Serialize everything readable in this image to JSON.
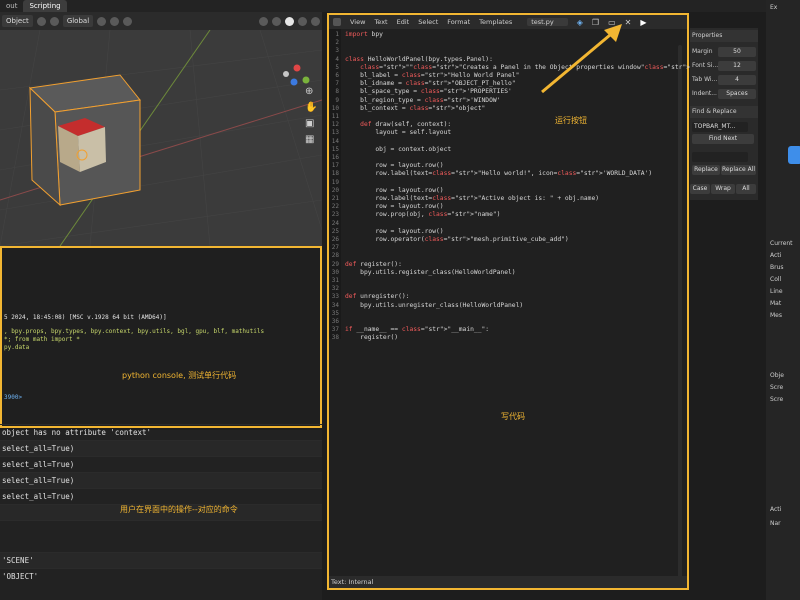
{
  "topbar": {
    "tabs": [
      "out",
      "Scripting"
    ]
  },
  "viewport_header": {
    "mode": "Object",
    "transform": "Global"
  },
  "console": {
    "lines": [
      "5 2024, 18:45:08) [MSC v.1928 64 bit (AMD64)]",
      ", bpy.props, bpy.types, bpy.context, bpy.utils, bgl, gpu, blf, mathutils",
      "*; from math import *",
      "py.data",
      "3900>"
    ],
    "annotation": "python console, 测试单行代码"
  },
  "infolog": {
    "rows": [
      "object has no attribute 'context'",
      "select_all=True)",
      "select_all=True)",
      "select_all=True)",
      "select_all=True)",
      "",
      "",
      "'SCENE'",
      "'OBJECT'"
    ],
    "annotation": "用户在界面中的操作--对应的命令"
  },
  "editor": {
    "menu": [
      "View",
      "Text",
      "Edit",
      "Select",
      "Format",
      "Templates"
    ],
    "filename": "test.py",
    "footer": "Text: Internal",
    "write_label": "写代码",
    "run_label": "运行按钮",
    "code": [
      "import bpy",
      "",
      "",
      "class HelloWorldPanel(bpy.types.Panel):",
      "    \"\"\"Creates a Panel in the Object properties window\"\"\"",
      "    bl_label = \"Hello World Panel\"",
      "    bl_idname = \"OBJECT_PT_hello\"",
      "    bl_space_type = 'PROPERTIES'",
      "    bl_region_type = 'WINDOW'",
      "    bl_context = \"object\"",
      "",
      "    def draw(self, context):",
      "        layout = self.layout",
      "",
      "        obj = context.object",
      "",
      "        row = layout.row()",
      "        row.label(text=\"Hello world!\", icon='WORLD_DATA')",
      "",
      "        row = layout.row()",
      "        row.label(text=\"Active object is: \" + obj.name)",
      "        row = layout.row()",
      "        row.prop(obj, \"name\")",
      "",
      "        row = layout.row()",
      "        row.operator(\"mesh.primitive_cube_add\")",
      "",
      "",
      "def register():",
      "    bpy.utils.register_class(HelloWorldPanel)",
      "",
      "",
      "def unregister():",
      "    bpy.utils.unregister_class(HelloWorldPanel)",
      "",
      "",
      "if __name__ == \"__main__\":",
      "    register()"
    ]
  },
  "sidebar": {
    "properties": "Properties",
    "margin": "Margin",
    "margin_val": "50",
    "font_size": "Font Si...",
    "font_size_val": "12",
    "tab_width": "Tab Wi...",
    "tab_width_val": "4",
    "indent": "Indent...",
    "indent_val": "Spaces",
    "find_replace": "Find & Replace",
    "find_field": "TOPBAR_MT...",
    "find_next": "Find Next",
    "replace": "Replace",
    "replace_all": "Replace All",
    "case": "Case",
    "wrap": "Wrap",
    "all": "All"
  },
  "outliner": {
    "rows": [
      "Ex",
      "Current",
      "Acti",
      "Brus",
      "Coll",
      "Line",
      "Mat",
      "Mes",
      "Obje",
      "Scre",
      "Scre",
      "Acti",
      "Nar"
    ]
  }
}
